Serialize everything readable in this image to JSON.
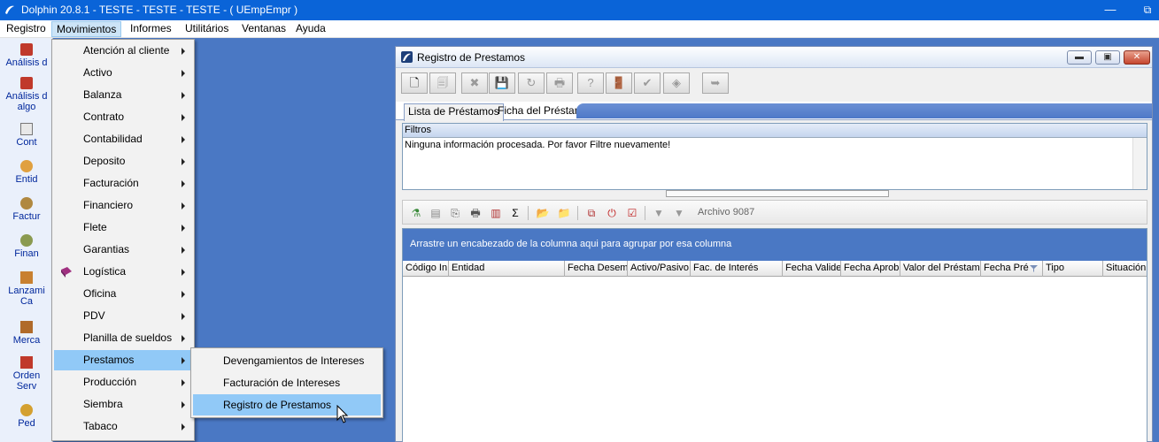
{
  "app": {
    "title": "Dolphin 20.8.1 - TESTE - TESTE - TESTE -  ( UEmpEmpr )",
    "restore_glyph": "⧉"
  },
  "menubar": [
    {
      "label": "Registro"
    },
    {
      "label": "Movimientos"
    },
    {
      "label": "Informes"
    },
    {
      "label": "Utilitários"
    },
    {
      "label": "Ventanas"
    },
    {
      "label": "Ayuda"
    }
  ],
  "sidebar": [
    {
      "label": "Análisis d",
      "icon": "analysis-icon"
    },
    {
      "label": "Análisis d",
      "label2": "algo",
      "icon": "analysis-algo-icon"
    },
    {
      "label": "Cont",
      "icon": "contract-icon"
    },
    {
      "label": "Entid",
      "icon": "entity-icon"
    },
    {
      "label": "Factur",
      "icon": "invoice-icon"
    },
    {
      "label": "Finan",
      "icon": "finance-icon"
    },
    {
      "label": "Lanzami",
      "label2": "Ca",
      "icon": "truck-icon"
    },
    {
      "label": "Merca",
      "icon": "merchandise-icon"
    },
    {
      "label": "Orden",
      "label2": "Serv",
      "icon": "order-icon"
    },
    {
      "label": "Ped",
      "icon": "order-bag-icon"
    }
  ],
  "movimientos_menu": [
    {
      "label": "Atención al cliente"
    },
    {
      "label": "Activo"
    },
    {
      "label": "Balanza"
    },
    {
      "label": "Contrato"
    },
    {
      "label": "Contabilidad"
    },
    {
      "label": "Deposito"
    },
    {
      "label": "Facturación"
    },
    {
      "label": "Financiero"
    },
    {
      "label": "Flete"
    },
    {
      "label": "Garantias"
    },
    {
      "label": "Logística"
    },
    {
      "label": "Oficina"
    },
    {
      "label": "PDV"
    },
    {
      "label": "Planilla de sueldos"
    },
    {
      "label": "Prestamos"
    },
    {
      "label": "Producción"
    },
    {
      "label": "Siembra"
    },
    {
      "label": "Tabaco"
    }
  ],
  "prestamos_submenu": [
    {
      "label": "Devengamientos de Intereses"
    },
    {
      "label": "Facturación de Intereses"
    },
    {
      "label": "Registro de Prestamos"
    }
  ],
  "window": {
    "title": "Registro de Prestamos",
    "buttons": {
      "minimize": "▬",
      "maximize": "▣",
      "close": "✕"
    },
    "toolbar": [
      "🗋",
      "🗐",
      "✖",
      "💾",
      "↻",
      "🖶",
      "?",
      "🚪",
      "✔",
      "◈",
      "➥"
    ],
    "tabs": [
      "Lista de Préstamos",
      "Ficha del Préstamo"
    ],
    "filters": {
      "header": "Filtros",
      "message": "Ninguna información procesada. Por favor Filtre nuevamente!"
    },
    "grid_toolbar": [
      "⚗",
      "▤",
      "⎘",
      "🖶",
      "▥",
      "Σ",
      "📂",
      "📁",
      "⧉",
      "⏻",
      "☑",
      "▼",
      "▼"
    ],
    "record_count": "Archivo 9087",
    "group_bar": "Arrastre un encabezado de la columna aqui para agrupar por esa columna",
    "columns": [
      "Código In",
      "Entidad",
      "Fecha Desem",
      "Activo/Pasivo",
      "Fac. de Interés",
      "Fecha Valide",
      "Fecha Aprob",
      "Valor del Préstamo",
      "Fecha Pré",
      "Tipo",
      "Situación"
    ]
  }
}
